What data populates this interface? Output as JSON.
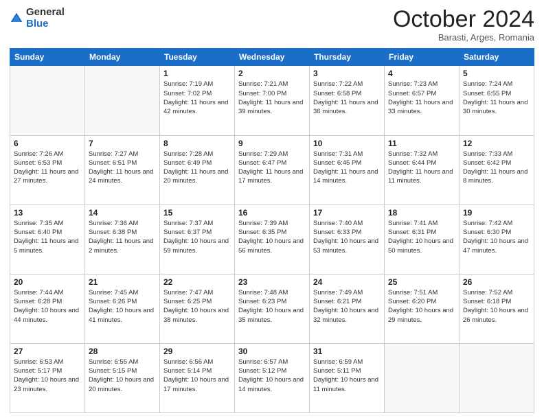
{
  "header": {
    "logo_general": "General",
    "logo_blue": "Blue",
    "month_title": "October 2024",
    "subtitle": "Barasti, Arges, Romania"
  },
  "calendar": {
    "days_of_week": [
      "Sunday",
      "Monday",
      "Tuesday",
      "Wednesday",
      "Thursday",
      "Friday",
      "Saturday"
    ],
    "weeks": [
      [
        {
          "day": "",
          "info": ""
        },
        {
          "day": "",
          "info": ""
        },
        {
          "day": "1",
          "info": "Sunrise: 7:19 AM\nSunset: 7:02 PM\nDaylight: 11 hours and 42 minutes."
        },
        {
          "day": "2",
          "info": "Sunrise: 7:21 AM\nSunset: 7:00 PM\nDaylight: 11 hours and 39 minutes."
        },
        {
          "day": "3",
          "info": "Sunrise: 7:22 AM\nSunset: 6:58 PM\nDaylight: 11 hours and 36 minutes."
        },
        {
          "day": "4",
          "info": "Sunrise: 7:23 AM\nSunset: 6:57 PM\nDaylight: 11 hours and 33 minutes."
        },
        {
          "day": "5",
          "info": "Sunrise: 7:24 AM\nSunset: 6:55 PM\nDaylight: 11 hours and 30 minutes."
        }
      ],
      [
        {
          "day": "6",
          "info": "Sunrise: 7:26 AM\nSunset: 6:53 PM\nDaylight: 11 hours and 27 minutes."
        },
        {
          "day": "7",
          "info": "Sunrise: 7:27 AM\nSunset: 6:51 PM\nDaylight: 11 hours and 24 minutes."
        },
        {
          "day": "8",
          "info": "Sunrise: 7:28 AM\nSunset: 6:49 PM\nDaylight: 11 hours and 20 minutes."
        },
        {
          "day": "9",
          "info": "Sunrise: 7:29 AM\nSunset: 6:47 PM\nDaylight: 11 hours and 17 minutes."
        },
        {
          "day": "10",
          "info": "Sunrise: 7:31 AM\nSunset: 6:45 PM\nDaylight: 11 hours and 14 minutes."
        },
        {
          "day": "11",
          "info": "Sunrise: 7:32 AM\nSunset: 6:44 PM\nDaylight: 11 hours and 11 minutes."
        },
        {
          "day": "12",
          "info": "Sunrise: 7:33 AM\nSunset: 6:42 PM\nDaylight: 11 hours and 8 minutes."
        }
      ],
      [
        {
          "day": "13",
          "info": "Sunrise: 7:35 AM\nSunset: 6:40 PM\nDaylight: 11 hours and 5 minutes."
        },
        {
          "day": "14",
          "info": "Sunrise: 7:36 AM\nSunset: 6:38 PM\nDaylight: 11 hours and 2 minutes."
        },
        {
          "day": "15",
          "info": "Sunrise: 7:37 AM\nSunset: 6:37 PM\nDaylight: 10 hours and 59 minutes."
        },
        {
          "day": "16",
          "info": "Sunrise: 7:39 AM\nSunset: 6:35 PM\nDaylight: 10 hours and 56 minutes."
        },
        {
          "day": "17",
          "info": "Sunrise: 7:40 AM\nSunset: 6:33 PM\nDaylight: 10 hours and 53 minutes."
        },
        {
          "day": "18",
          "info": "Sunrise: 7:41 AM\nSunset: 6:31 PM\nDaylight: 10 hours and 50 minutes."
        },
        {
          "day": "19",
          "info": "Sunrise: 7:42 AM\nSunset: 6:30 PM\nDaylight: 10 hours and 47 minutes."
        }
      ],
      [
        {
          "day": "20",
          "info": "Sunrise: 7:44 AM\nSunset: 6:28 PM\nDaylight: 10 hours and 44 minutes."
        },
        {
          "day": "21",
          "info": "Sunrise: 7:45 AM\nSunset: 6:26 PM\nDaylight: 10 hours and 41 minutes."
        },
        {
          "day": "22",
          "info": "Sunrise: 7:47 AM\nSunset: 6:25 PM\nDaylight: 10 hours and 38 minutes."
        },
        {
          "day": "23",
          "info": "Sunrise: 7:48 AM\nSunset: 6:23 PM\nDaylight: 10 hours and 35 minutes."
        },
        {
          "day": "24",
          "info": "Sunrise: 7:49 AM\nSunset: 6:21 PM\nDaylight: 10 hours and 32 minutes."
        },
        {
          "day": "25",
          "info": "Sunrise: 7:51 AM\nSunset: 6:20 PM\nDaylight: 10 hours and 29 minutes."
        },
        {
          "day": "26",
          "info": "Sunrise: 7:52 AM\nSunset: 6:18 PM\nDaylight: 10 hours and 26 minutes."
        }
      ],
      [
        {
          "day": "27",
          "info": "Sunrise: 6:53 AM\nSunset: 5:17 PM\nDaylight: 10 hours and 23 minutes."
        },
        {
          "day": "28",
          "info": "Sunrise: 6:55 AM\nSunset: 5:15 PM\nDaylight: 10 hours and 20 minutes."
        },
        {
          "day": "29",
          "info": "Sunrise: 6:56 AM\nSunset: 5:14 PM\nDaylight: 10 hours and 17 minutes."
        },
        {
          "day": "30",
          "info": "Sunrise: 6:57 AM\nSunset: 5:12 PM\nDaylight: 10 hours and 14 minutes."
        },
        {
          "day": "31",
          "info": "Sunrise: 6:59 AM\nSunset: 5:11 PM\nDaylight: 10 hours and 11 minutes."
        },
        {
          "day": "",
          "info": ""
        },
        {
          "day": "",
          "info": ""
        }
      ]
    ]
  }
}
